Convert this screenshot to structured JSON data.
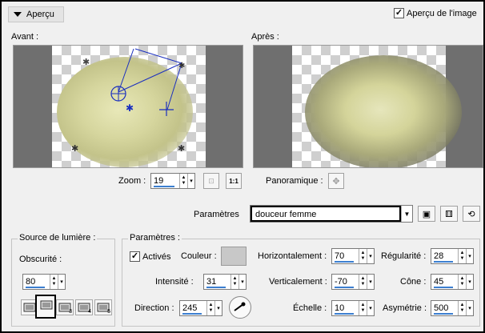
{
  "header": {
    "section_label": "Aperçu",
    "preview_checkbox_label": "Aperçu de l'image",
    "preview_checked": true
  },
  "before_label": "Avant :",
  "after_label": "Après :",
  "zoom": {
    "label": "Zoom :",
    "value": "19",
    "one_to_one": "1:1"
  },
  "pan_label": "Panoramique :",
  "presets": {
    "label": "Paramètres",
    "value": "douceur femme"
  },
  "light_source": {
    "title": "Source de lumière :",
    "darkness_label": "Obscurité :",
    "darkness_value": "80",
    "preset_numbers": [
      "",
      "2",
      "3",
      "4",
      "5"
    ]
  },
  "params": {
    "title": "Paramètres :",
    "active_label": "Activés",
    "active_checked": true,
    "color_label": "Couleur :",
    "color_value": "#c8c8c8",
    "intensity_label": "Intensité :",
    "intensity_value": "31",
    "direction_label": "Direction :",
    "direction_value": "245",
    "horizontal_label": "Horizontalement :",
    "horizontal_value": "70",
    "vertical_label": "Verticalement :",
    "vertical_value": "-70",
    "scale_label": "Échelle :",
    "scale_value": "10",
    "regularity_label": "Régularité :",
    "regularity_value": "28",
    "cone_label": "Cône :",
    "cone_value": "45",
    "asymmetry_label": "Asymétrie :",
    "asymmetry_value": "500"
  }
}
